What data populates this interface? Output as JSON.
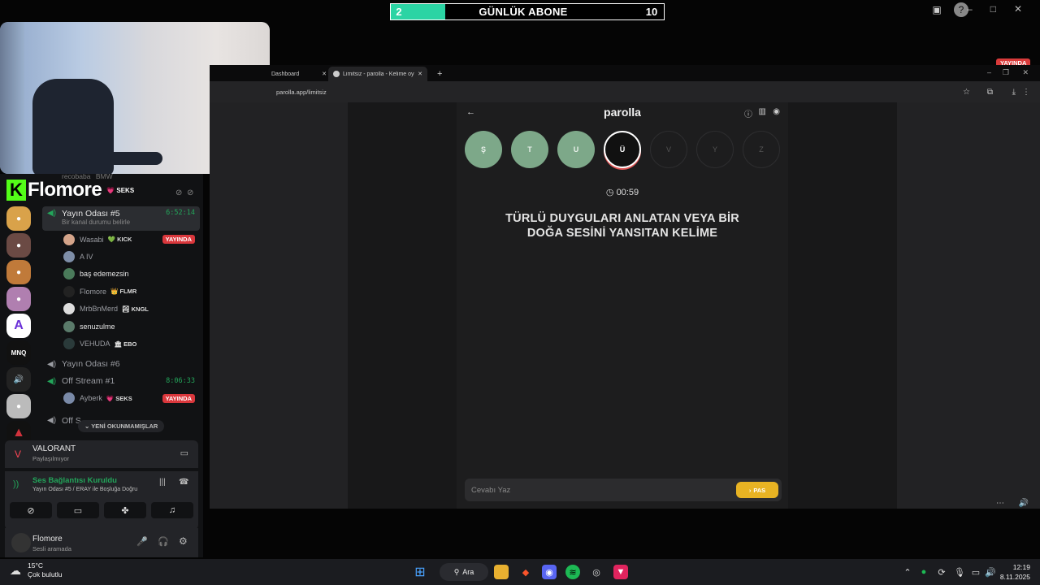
{
  "overlay": {
    "sub_current": "2",
    "sub_title": "GÜNLÜK ABONE",
    "sub_goal": "10",
    "sub_progress": 0.2
  },
  "discord": {
    "server": {
      "name": "Flomore",
      "tag": "💗 SEKS",
      "prev_user": "recobaba",
      "prev_badge": "BMW"
    },
    "server_icons": [
      "MNQ"
    ],
    "channels": [
      {
        "name": "Yayın Odası #5",
        "time": "6:52:14",
        "status": "Bir kanal durumu belirle",
        "users": [
          {
            "name": "Wasabi",
            "badge": "💚 KICK",
            "live": "YAYINDA"
          },
          {
            "name": "A IV",
            "badge": ""
          },
          {
            "name": "baş edemezsin",
            "badge": ""
          },
          {
            "name": "Flomore",
            "badge": "👑 FLMR"
          },
          {
            "name": "MrbBnMerd",
            "badge": "🏞 KNGL"
          },
          {
            "name": "senuzulme",
            "badge": ""
          },
          {
            "name": "VEHUDA",
            "badge": "🏛 EBO"
          }
        ]
      },
      {
        "name": "Yayın Odası #6"
      },
      {
        "name": "Off Stream #1",
        "time": "8:06:33",
        "users": [
          {
            "name": "Ayberk",
            "badge": "💗 SEKS",
            "live": "YAYINDA"
          }
        ]
      },
      {
        "name": "Off S"
      }
    ],
    "new_unread": "YENİ OKUNMAMIŞLAR",
    "game": {
      "title": "VALORANT",
      "status": "Paylaşılmıyor"
    },
    "voice": {
      "title": "Ses Bağlantısı Kuruldu",
      "detail": "Yayın Odası #5 / ERAY ile Boşluğa Doğru"
    },
    "user": {
      "name": "Flomore",
      "status": "Sesli aramada"
    }
  },
  "browser": {
    "tabs": [
      "Dashboard",
      "Limitsiz - parolla - Kelime oyunu"
    ],
    "url": "parolla.app/limitsiz",
    "live_badge": "YAYINDA"
  },
  "game": {
    "brand": "parolla",
    "letters": [
      {
        "l": "Ş",
        "state": "done"
      },
      {
        "l": "T",
        "state": "done"
      },
      {
        "l": "U",
        "state": "done"
      },
      {
        "l": "Ü",
        "state": "current"
      },
      {
        "l": "V",
        "state": "todo"
      },
      {
        "l": "Y",
        "state": "todo"
      },
      {
        "l": "Z",
        "state": "todo"
      }
    ],
    "timer": "00:59",
    "question_line1": "TÜRLÜ DUYGULARI ANLATAN VEYA BİR",
    "question_line2": "DOĞA SESİNİ YANSITAN KELİME",
    "answer_placeholder": "Cevabı Yaz",
    "pass_label": "PAS"
  },
  "taskbar": {
    "temp": "15°C",
    "weather": "Çok bulutlu",
    "search": "Ara",
    "time": "12:19",
    "date": "8.11.2025"
  }
}
